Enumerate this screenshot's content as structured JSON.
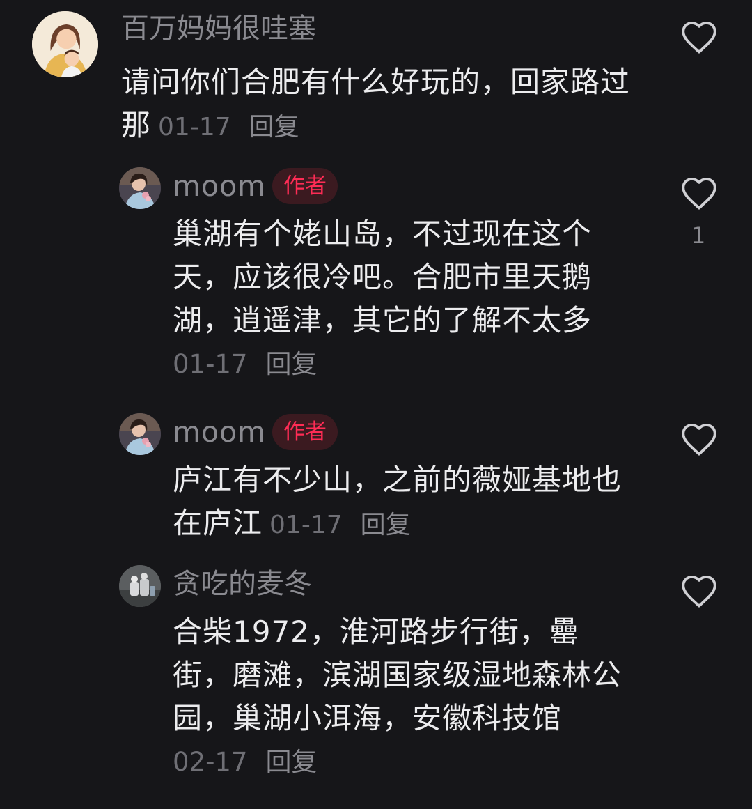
{
  "comments": [
    {
      "username": "百万妈妈很哇塞",
      "text": "请问你们合肥有什么好玩的，回家路过那",
      "date": "01-17",
      "reply_label": "回复",
      "avatar_icon": "avatar-cartoon-mother-child"
    },
    {
      "username": "moom",
      "badge": "作者",
      "text": "巢湖有个姥山岛，不过现在这个天，应该很冷吧。合肥市里天鹅湖，逍遥津，其它的了解不太多",
      "date": "01-17",
      "reply_label": "回复",
      "like_count": "1",
      "avatar_icon": "avatar-photo-woman"
    },
    {
      "username": "moom",
      "badge": "作者",
      "text": "庐江有不少山，之前的薇娅基地也在庐江",
      "date": "01-17",
      "reply_label": "回复",
      "avatar_icon": "avatar-photo-woman"
    },
    {
      "username": "贪吃的麦冬",
      "text": "合柴1972，淮河路步行街，罍街，磨滩，滨湖国家级湿地森林公园，巢湖小洱海，安徽科技馆",
      "date": "02-17",
      "reply_label": "回复",
      "avatar_icon": "avatar-photo-figurine"
    }
  ],
  "colors": {
    "background": "#161619",
    "text": "#ececee",
    "muted": "#8a8a90",
    "date": "#6f6f75",
    "author_badge_text": "#fe2c55",
    "author_badge_bg": "#3b1a20"
  },
  "icons": {
    "like": "heart-outline-icon"
  }
}
